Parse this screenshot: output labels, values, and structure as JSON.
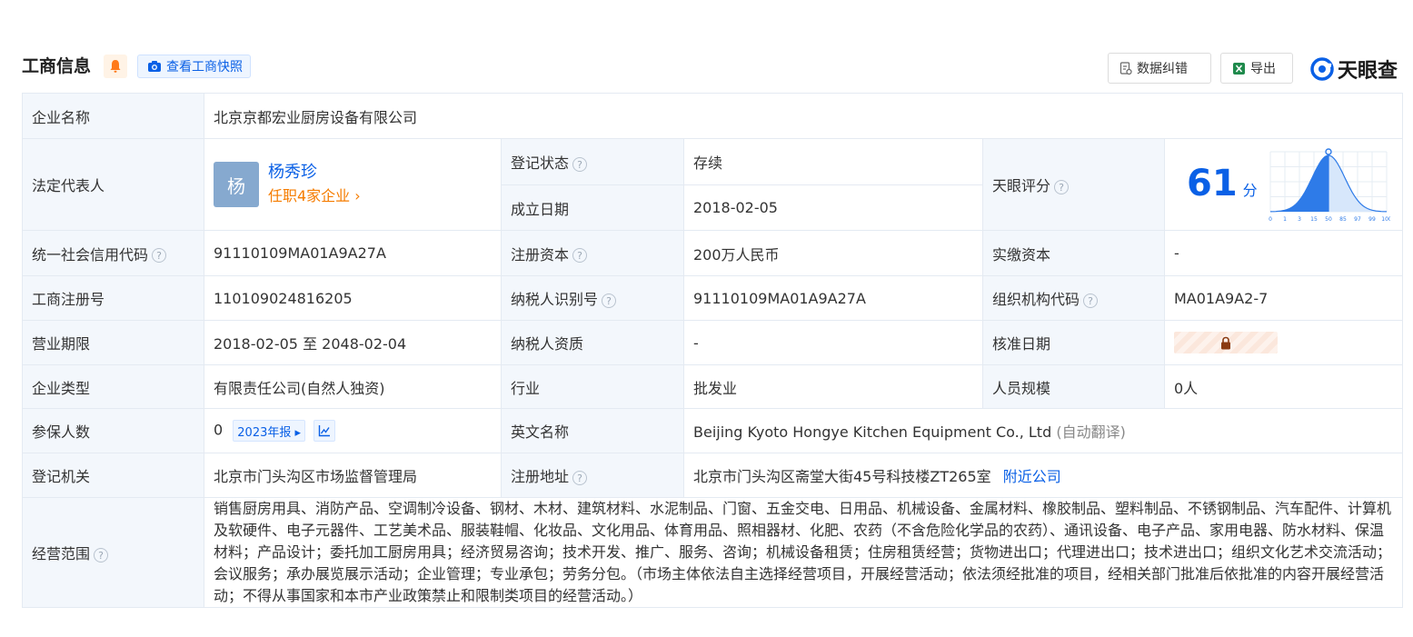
{
  "header": {
    "title": "工商信息",
    "snapshot_label": "查看工商快照",
    "correct_label": "数据纠错",
    "export_label": "导出",
    "logo_text": "天眼查",
    "accent": "#0a60e6"
  },
  "labels": {
    "company_name": "企业名称",
    "legal_rep": "法定代表人",
    "reg_status": "登记状态",
    "est_date": "成立日期",
    "tianyan_score": "天眼评分",
    "credit_code": "统一社会信用代码",
    "reg_capital": "注册资本",
    "paid_capital": "实缴资本",
    "reg_number": "工商注册号",
    "taxpayer_id": "纳税人识别号",
    "org_code": "组织机构代码",
    "business_term": "营业期限",
    "taxpayer_qual": "纳税人资质",
    "approval_date": "核准日期",
    "company_type": "企业类型",
    "industry": "行业",
    "staff_size": "人员规模",
    "insured": "参保人数",
    "english_name": "英文名称",
    "reg_authority": "登记机关",
    "reg_address": "注册地址",
    "business_scope": "经营范围"
  },
  "values": {
    "company_name": "北京京都宏业厨房设备有限公司",
    "legal_rep_avatar": "杨",
    "legal_rep_name": "杨秀珍",
    "legal_rep_link": "任职4家企业 ›",
    "reg_status": "存续",
    "est_date": "2018-02-05",
    "score": "61",
    "score_unit": "分",
    "credit_code": "91110109MA01A9A27A",
    "reg_capital": "200万人民币",
    "paid_capital": "-",
    "reg_number": "110109024816205",
    "taxpayer_id": "91110109MA01A9A27A",
    "org_code": "MA01A9A2-7",
    "business_term": "2018-02-05 至 2048-02-04",
    "taxpayer_qual": "-",
    "company_type": "有限责任公司(自然人独资)",
    "industry": "批发业",
    "staff_size": "0人",
    "insured": "0",
    "insured_report": "2023年报 ▸",
    "english_name": "Beijing Kyoto Hongye Kitchen Equipment Co., Ltd",
    "english_note": "(自动翻译)",
    "reg_authority": "北京市门头沟区市场监督管理局",
    "reg_address": "北京市门头沟区斋堂大街45号科技楼ZT265室",
    "nearby_link": "附近公司",
    "business_scope": "销售厨房用具、消防产品、空调制冷设备、钢材、木材、建筑材料、水泥制品、门窗、五金交电、日用品、机械设备、金属材料、橡胶制品、塑料制品、不锈钢制品、汽车配件、计算机及软硬件、电子元器件、工艺美术品、服装鞋帽、化妆品、文化用品、体育用品、照相器材、化肥、农药（不含危险化学品的农药）、通讯设备、电子产品、家用电器、防水材料、保温材料；产品设计；委托加工厨房用具；经济贸易咨询；技术开发、推广、服务、咨询；机械设备租赁；住房租赁经营；货物进出口；代理进出口；技术进出口；组织文化艺术交流活动；会议服务；承办展览展示活动；企业管理；专业承包；劳务分包。（市场主体依法自主选择经营项目，开展经营活动；依法须经批准的项目，经相关部门批准后依批准的内容开展经营活动；不得从事国家和本市产业政策禁止和限制类项目的经营活动。）"
  },
  "score_chart": {
    "ticks": [
      "0",
      "1",
      "3",
      "15",
      "50",
      "85",
      "97",
      "99",
      "100"
    ],
    "marker_tick_index": 4
  }
}
